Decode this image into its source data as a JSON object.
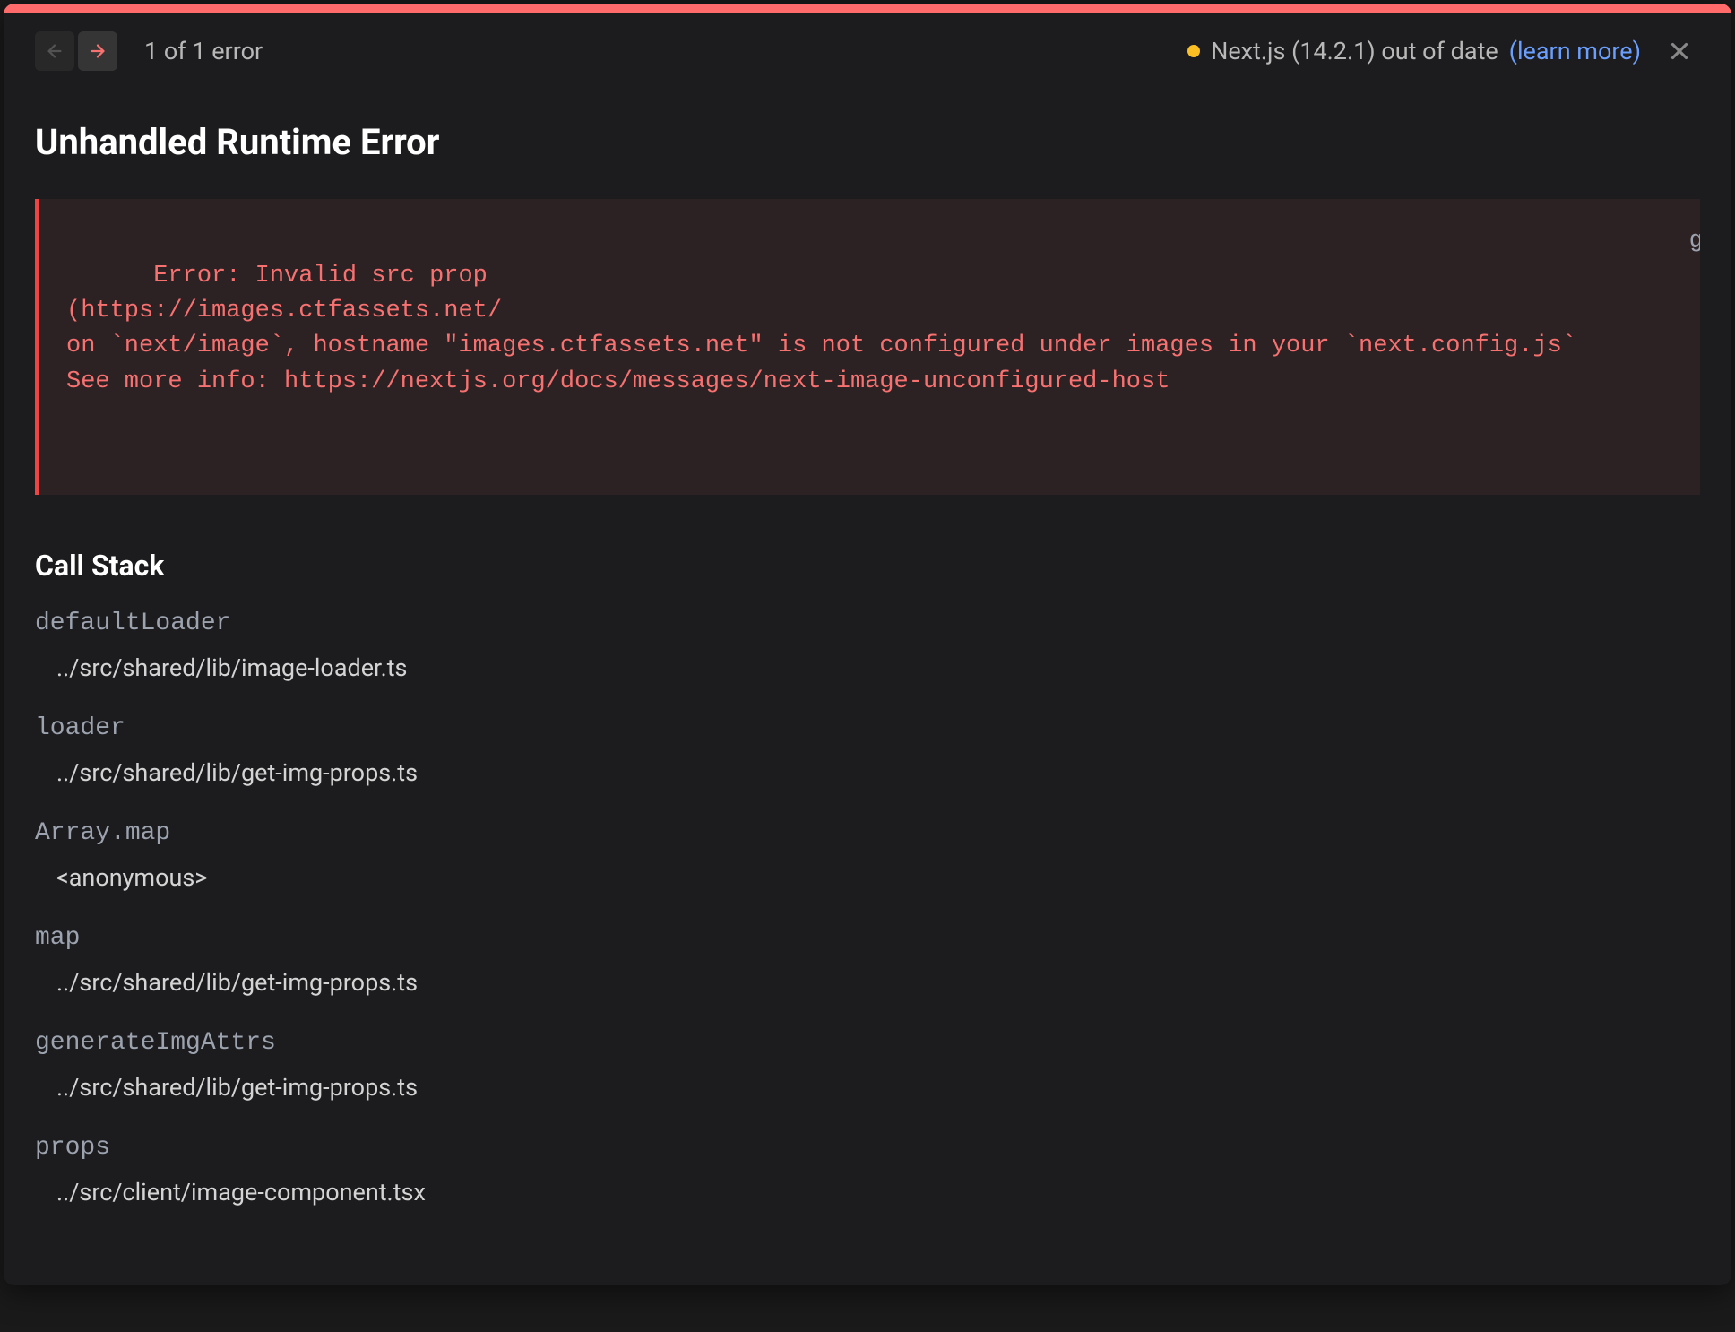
{
  "header": {
    "error_count": "1 of 1 error",
    "status_text": "Next.js (14.2.1) out of date",
    "learn_more_text": "(learn more)"
  },
  "error": {
    "title": "Unhandled Runtime Error",
    "message": "Error: Invalid src prop\n(https://images.ctfassets.net/\non `next/image`, hostname \"images.ctfassets.net\" is not configured under images in your `next.config.js`\nSee more info: https://nextjs.org/docs/messages/next-image-unconfigured-host",
    "partial_background_text": "gn"
  },
  "call_stack": {
    "title": "Call Stack",
    "frames": [
      {
        "name": "defaultLoader",
        "source": "../src/shared/lib/image-loader.ts"
      },
      {
        "name": "loader",
        "source": "../src/shared/lib/get-img-props.ts"
      },
      {
        "name": "Array.map",
        "source": "<anonymous>"
      },
      {
        "name": "map",
        "source": "../src/shared/lib/get-img-props.ts"
      },
      {
        "name": "generateImgAttrs",
        "source": "../src/shared/lib/get-img-props.ts"
      },
      {
        "name": "props",
        "source": "../src/client/image-component.tsx"
      }
    ]
  }
}
